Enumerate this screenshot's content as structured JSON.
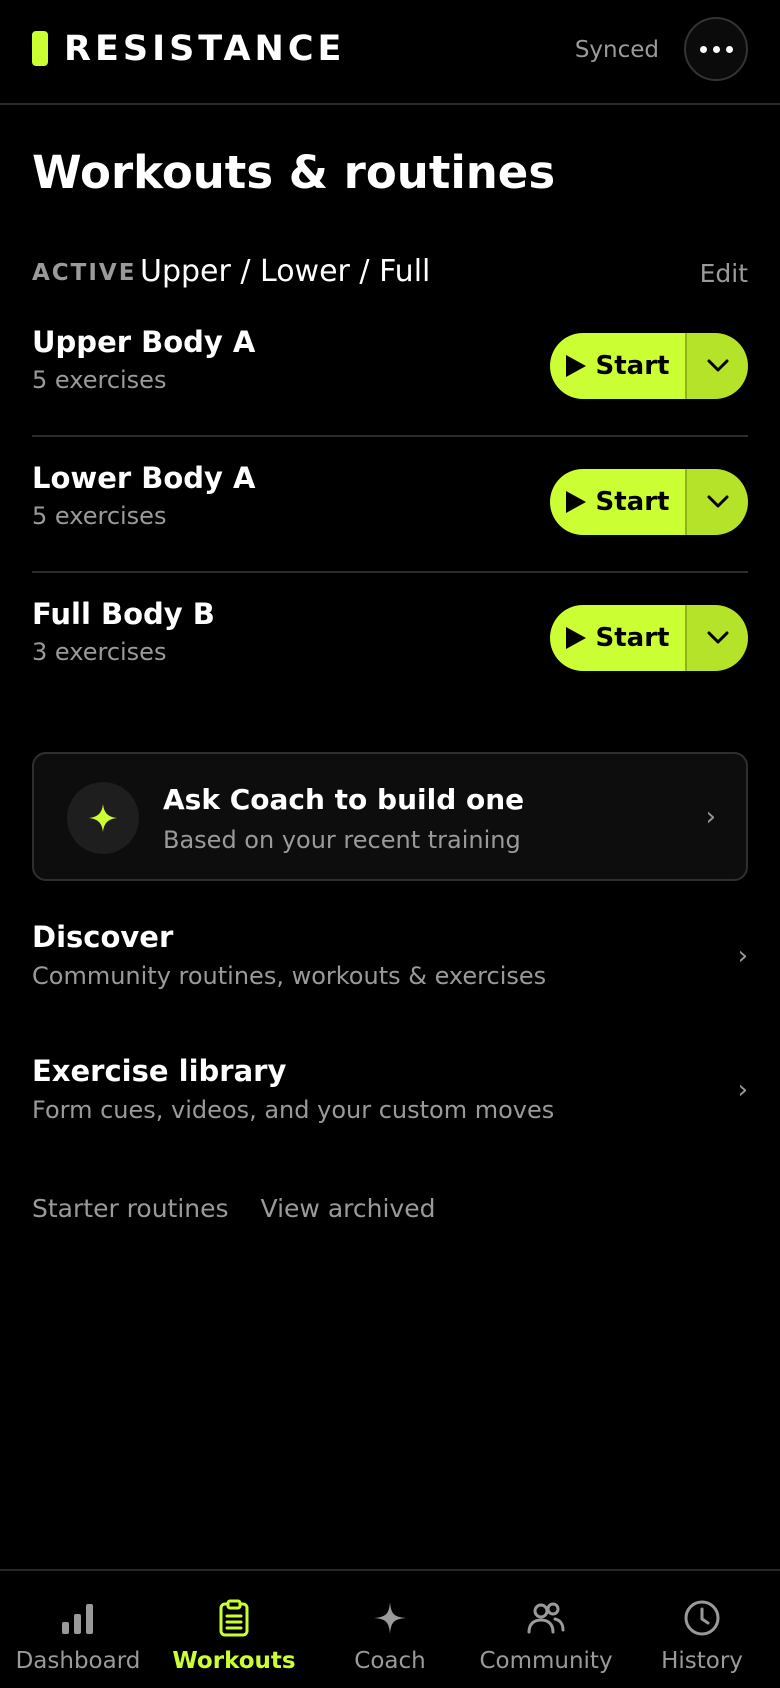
{
  "header": {
    "brand": "RESISTANCE",
    "sync_status": "Synced",
    "more_icon": "more-horizontal-icon"
  },
  "page": {
    "title": "Workouts & routines"
  },
  "active_program": {
    "tag": "ACTIVE",
    "name": "Upper / Lower / Full",
    "edit_label": "Edit"
  },
  "routines": [
    {
      "name": "Upper Body A",
      "count": "5 exercises",
      "start_label": "Start"
    },
    {
      "name": "Lower Body A",
      "count": "5 exercises",
      "start_label": "Start"
    },
    {
      "name": "Full Body B",
      "count": "3 exercises",
      "start_label": "Start"
    }
  ],
  "coach_card": {
    "title": "Ask Coach to build one",
    "subtitle": "Based on your recent training",
    "icon": "sparkle-icon",
    "chevron": "›"
  },
  "links": [
    {
      "title": "Discover",
      "subtitle": "Community routines, workouts & exercises",
      "chevron": "›"
    },
    {
      "title": "Exercise library",
      "subtitle": "Form cues, videos, and your custom moves",
      "chevron": "›"
    }
  ],
  "footer_links": {
    "starter": "Starter routines",
    "archived": "View archived"
  },
  "tabbar": {
    "active": "Workouts",
    "tabs": [
      {
        "label": "Dashboard",
        "icon": "bar-chart-icon"
      },
      {
        "label": "Workouts",
        "icon": "clipboard-icon"
      },
      {
        "label": "Coach",
        "icon": "sparkle-icon"
      },
      {
        "label": "Community",
        "icon": "users-icon"
      },
      {
        "label": "History",
        "icon": "clock-icon"
      }
    ]
  },
  "colors": {
    "accent": "#ccff33",
    "accent_dark": "#b5e32a",
    "muted_text": "#9a9a9a",
    "background": "#000000"
  }
}
